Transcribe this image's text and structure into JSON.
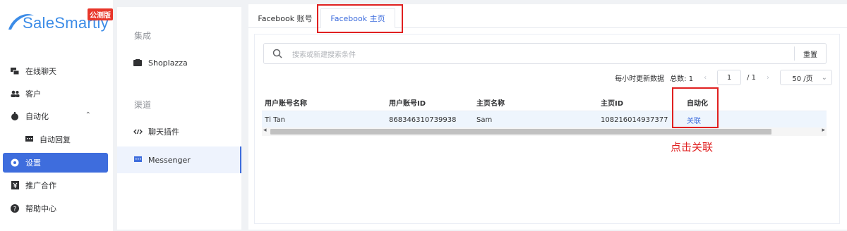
{
  "brand": {
    "name": "SaleSmartly",
    "badge": "公测版"
  },
  "nav": {
    "items": [
      {
        "label": "在线聊天",
        "icon": "chat-icon"
      },
      {
        "label": "客户",
        "icon": "users-icon"
      },
      {
        "label": "自动化",
        "icon": "automation-icon",
        "chevron": "⌃"
      },
      {
        "label": "自动回复",
        "icon": "auto-reply-icon"
      },
      {
        "label": "设置",
        "icon": "settings-icon"
      },
      {
        "label": "推广合作",
        "icon": "promotion-icon"
      },
      {
        "label": "帮助中心",
        "icon": "help-icon"
      }
    ]
  },
  "middle": {
    "group1": "集成",
    "item_shoplazza": "Shoplazza",
    "group2": "渠道",
    "item_plugin": "聊天插件",
    "item_messenger": "Messenger"
  },
  "tabs": {
    "tab1": "Facebook 账号",
    "tab2": "Facebook 主页"
  },
  "search": {
    "placeholder": "搜索或新建搜索条件",
    "reset": "重置"
  },
  "pager": {
    "refresh_note": "每小时更新数据",
    "total": "总数: 1",
    "prev": "‹",
    "current": "1",
    "of": "/ 1",
    "next": "›",
    "page_size": "50 /页"
  },
  "table": {
    "headers": [
      "用户账号名称",
      "用户账号ID",
      "主页名称",
      "主页ID",
      "自动化"
    ],
    "rows": [
      [
        "Tl Tan",
        "868346310739938",
        "Sam",
        "108216014937377",
        "关联"
      ]
    ]
  },
  "annotation": "点击关联",
  "colors": {
    "accent": "#3e6ddd",
    "highlight": "#e02020",
    "brand": "#3c8ce7"
  }
}
